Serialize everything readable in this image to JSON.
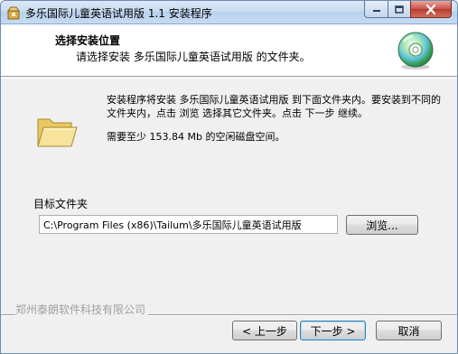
{
  "window": {
    "title": "多乐国际儿童英语试用版 1.1 安装程序"
  },
  "header": {
    "title": "选择安装位置",
    "subtitle": "请选择安装 多乐国际儿童英语试用版 的文件夹。"
  },
  "body": {
    "description": "安装程序将安装 多乐国际儿童英语试用版 到下面文件夹内。要安装到不同的文件夹内，点击 浏览 选择其它文件夹。点击 下一步 继续。",
    "space_required": "需要至少 153.84 Mb 的空闲磁盘空间。"
  },
  "destination": {
    "group_label": "目标文件夹",
    "path_value": "C:\\Program Files (x86)\\Tailum\\多乐国际儿童英语试用版",
    "browse_label": "浏览..."
  },
  "footer": {
    "company": "郑州泰朗软件科技有限公司",
    "back_label": "< 上一步",
    "next_label": "下一步 >",
    "cancel_label": "取消"
  },
  "icons": {
    "title_icon": "installer-box-icon",
    "header_icon": "cd-disc-icon",
    "folder_icon": "folder-open-icon"
  }
}
